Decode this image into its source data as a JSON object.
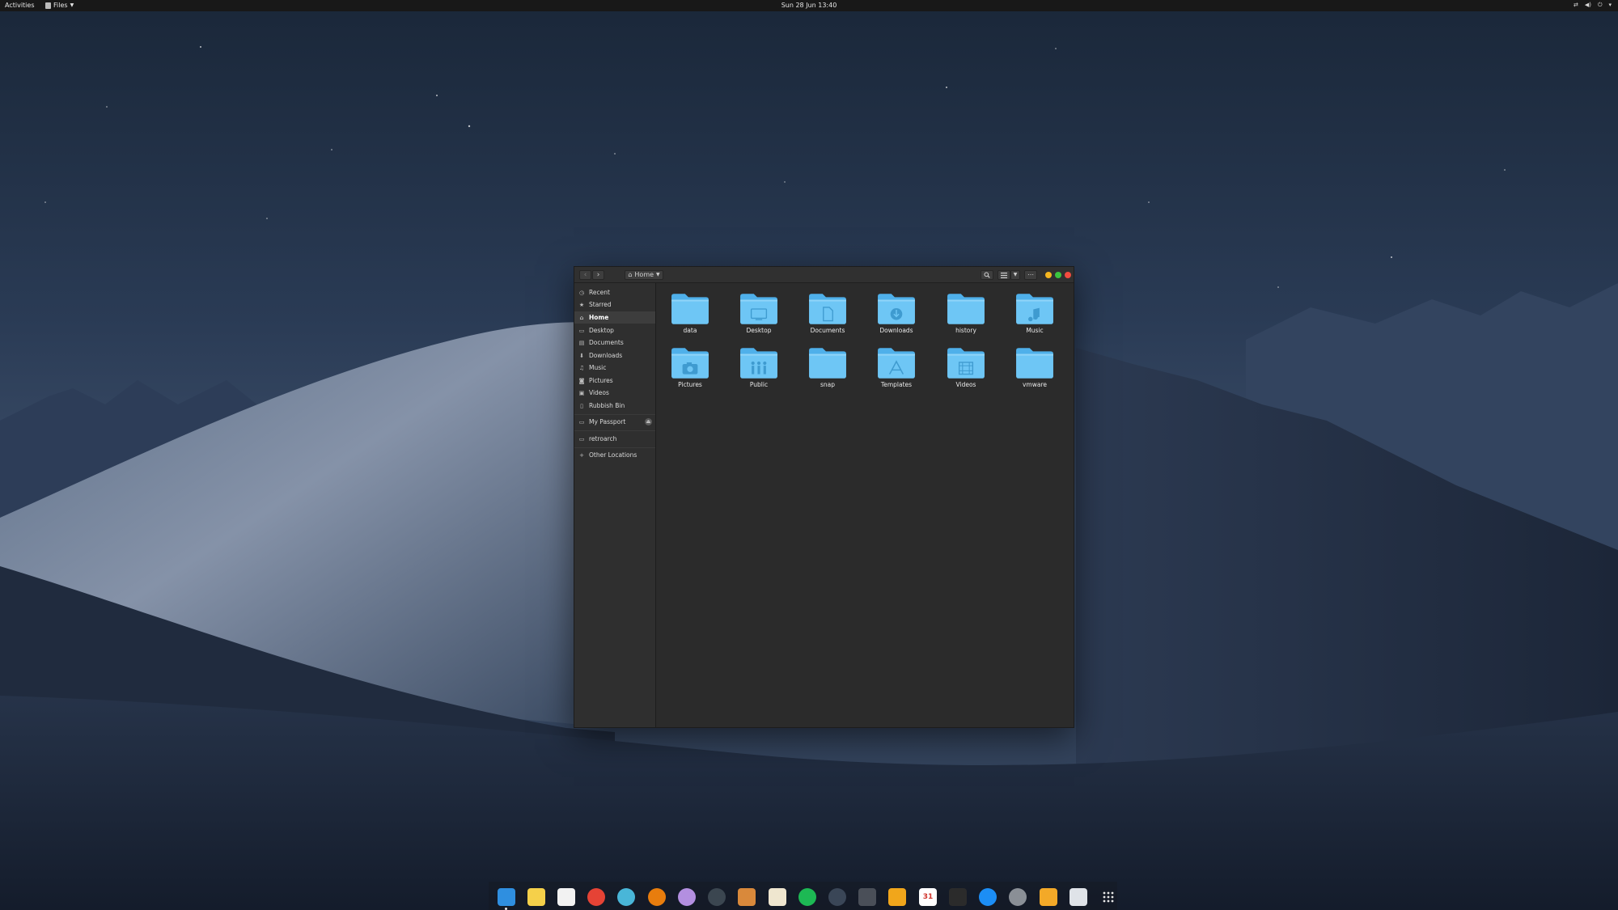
{
  "topbar": {
    "activities": "Activities",
    "app_menu": "Files",
    "clock": "Sun 28 Jun  13:40",
    "tray_icons": [
      "network-icon",
      "volume-icon",
      "power-icon",
      "chevron-down-icon"
    ]
  },
  "window": {
    "path": {
      "label": "Home",
      "icon": "home-icon"
    },
    "controls": {
      "minimize_color": "#f5b51f",
      "maximize_color": "#3ac33f",
      "close_color": "#f14b3f"
    },
    "sidebar": {
      "items": [
        {
          "label": "Recent",
          "icon": "clock-icon"
        },
        {
          "label": "Starred",
          "icon": "star-icon"
        },
        {
          "label": "Home",
          "icon": "home-icon",
          "active": true
        },
        {
          "label": "Desktop",
          "icon": "desktop-icon"
        },
        {
          "label": "Documents",
          "icon": "document-icon"
        },
        {
          "label": "Downloads",
          "icon": "download-icon"
        },
        {
          "label": "Music",
          "icon": "music-icon"
        },
        {
          "label": "Pictures",
          "icon": "camera-icon"
        },
        {
          "label": "Videos",
          "icon": "video-icon"
        },
        {
          "label": "Rubbish Bin",
          "icon": "trash-icon"
        }
      ],
      "devices": [
        {
          "label": "My Passport",
          "icon": "drive-icon",
          "eject": true
        },
        {
          "label": "retroarch",
          "icon": "drive-icon"
        }
      ],
      "other": {
        "label": "Other Locations",
        "icon": "plus-icon"
      }
    },
    "folders": [
      {
        "name": "data",
        "emblem": "none"
      },
      {
        "name": "Desktop",
        "emblem": "desktop"
      },
      {
        "name": "Documents",
        "emblem": "document"
      },
      {
        "name": "Downloads",
        "emblem": "download"
      },
      {
        "name": "history",
        "emblem": "none"
      },
      {
        "name": "Music",
        "emblem": "music"
      },
      {
        "name": "Pictures",
        "emblem": "camera"
      },
      {
        "name": "Public",
        "emblem": "people"
      },
      {
        "name": "snap",
        "emblem": "none"
      },
      {
        "name": "Templates",
        "emblem": "template"
      },
      {
        "name": "Videos",
        "emblem": "video"
      },
      {
        "name": "vmware",
        "emblem": "none"
      }
    ],
    "folder_color": "#6ec6f5"
  },
  "dock": {
    "items": [
      {
        "name": "finder-icon",
        "color": "#2f8fe0",
        "running": true
      },
      {
        "name": "notes-icon",
        "color": "#f5d04a"
      },
      {
        "name": "reminders-icon",
        "color": "#f2f2f2"
      },
      {
        "name": "chrome-icon",
        "color": "#e54335"
      },
      {
        "name": "mail-icon",
        "color": "#49b6d8"
      },
      {
        "name": "blender-icon",
        "color": "#e87d0d"
      },
      {
        "name": "inkscape-icon",
        "color": "#b38fe0"
      },
      {
        "name": "davinci-resolve-icon",
        "color": "#3b4650"
      },
      {
        "name": "guitar-icon",
        "color": "#d9893b"
      },
      {
        "name": "text-editor-icon",
        "color": "#efe6cf"
      },
      {
        "name": "spotify-icon",
        "color": "#1db954"
      },
      {
        "name": "steam-icon",
        "color": "#3a4657"
      },
      {
        "name": "gamepad-icon",
        "color": "#4a4f58"
      },
      {
        "name": "puzzle-icon",
        "color": "#f1a61b"
      },
      {
        "name": "calendar-icon",
        "color": "#ffffff",
        "text": "31"
      },
      {
        "name": "calculator-icon",
        "color": "#2b2b2b"
      },
      {
        "name": "app-store-icon",
        "color": "#1c8ef5"
      },
      {
        "name": "system-settings-icon",
        "color": "#8a8f96"
      },
      {
        "name": "files-icon",
        "color": "#f3a928"
      },
      {
        "name": "trash-icon",
        "color": "#dfe3e8"
      },
      {
        "name": "app-grid-icon",
        "color": "transparent"
      }
    ]
  }
}
